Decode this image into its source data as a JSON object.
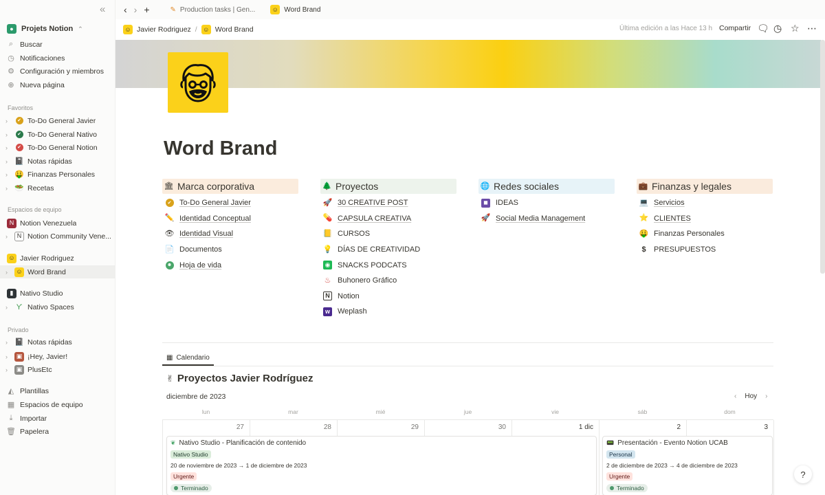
{
  "sidebar": {
    "workspace": "Projets Notion",
    "top": [
      {
        "label": "Buscar",
        "icon": "search-icon"
      },
      {
        "label": "Notificaciones",
        "icon": "clock-icon"
      },
      {
        "label": "Configuración y miembros",
        "icon": "gear-icon"
      },
      {
        "label": "Nueva página",
        "icon": "plus-circle-icon"
      }
    ],
    "favorites_title": "Favoritos",
    "favorites": [
      {
        "label": "To-Do General Javier",
        "icon": "check-circle-icon",
        "color": "#d9a21b"
      },
      {
        "label": "To-Do General Nativo",
        "icon": "check-circle-icon",
        "color": "#2b7a4b"
      },
      {
        "label": "To-Do General Notion",
        "icon": "check-circle-icon",
        "color": "#d44c47"
      },
      {
        "label": "Notas rápidas",
        "icon": "notebook-icon"
      },
      {
        "label": "Finanzas Personales",
        "icon": "money-face-icon"
      },
      {
        "label": "Recetas",
        "icon": "salad-icon"
      }
    ],
    "teams_title": "Espacios de equipo",
    "teams": [
      {
        "label": "Notion Venezuela",
        "icon": "team-logo-icon",
        "color": "#9b2b3a"
      },
      {
        "label": "Notion Community Vene...",
        "icon": "notion-logo-icon"
      },
      {
        "label": "Javier Rodriguez",
        "icon": "avatar-icon",
        "color": "#fbd11a"
      },
      {
        "label": "Word Brand",
        "icon": "avatar-icon",
        "color": "#fbd11a"
      },
      {
        "label": "Nativo Studio",
        "icon": "team-logo-icon",
        "color": "#2f3437"
      },
      {
        "label": "Nativo Spaces",
        "icon": "sprout-icon"
      }
    ],
    "private_title": "Privado",
    "private": [
      {
        "label": "Notas rápidas",
        "icon": "notebook-icon"
      },
      {
        "label": "¡Hey, Javier!",
        "icon": "photo-icon"
      },
      {
        "label": "PlusEtc",
        "icon": "photo-icon"
      }
    ],
    "bottom": [
      {
        "label": "Plantillas",
        "icon": "shapes-icon"
      },
      {
        "label": "Espacios de equipo",
        "icon": "building-icon"
      },
      {
        "label": "Importar",
        "icon": "download-icon"
      },
      {
        "label": "Papelera",
        "icon": "trash-icon"
      }
    ]
  },
  "tabs": [
    {
      "label": "Production tasks | Gen...",
      "icon": "paintbrush-icon"
    },
    {
      "label": "Word Brand",
      "icon": "avatar-icon"
    }
  ],
  "header": {
    "breadcrumb": [
      "Javier Rodriguez",
      "Word Brand"
    ],
    "breadcrumb_sep": "/",
    "last_edit": "Última edición a las Hace 13 h",
    "share": "Compartir"
  },
  "page": {
    "title": "Word Brand",
    "columns": [
      {
        "title": "Marca corporativa",
        "icon": "🏛",
        "bg": "#fbecdd",
        "items": [
          {
            "label": "To-Do General Javier",
            "icon": "✔",
            "color": "#d9a21b",
            "link": true
          },
          {
            "label": "Identidad Conceptual",
            "icon": "✏️",
            "link": true
          },
          {
            "label": "Identidad Visual",
            "icon": "👁",
            "link": true
          },
          {
            "label": "Documentos",
            "icon": "📄",
            "link": false
          },
          {
            "label": "Hoja de vida",
            "icon": "☻",
            "color": "#4aa66a",
            "link": true
          }
        ]
      },
      {
        "title": "Proyectos",
        "icon": "🌲",
        "bg": "#edf3ec",
        "items": [
          {
            "label": "30 CREATIVE POST",
            "icon": "🚀",
            "link": true
          },
          {
            "label": "CAPSULA CREATIVA",
            "icon": "💊",
            "link": true
          },
          {
            "label": "CURSOS",
            "icon": "📒",
            "link": false
          },
          {
            "label": "DÍAS DE CREATIVIDAD",
            "icon": "💡",
            "link": false
          },
          {
            "label": "SNACKS PODCATS",
            "icon": "◉",
            "color": "#1db954",
            "link": false
          },
          {
            "label": "Buhonero Gráfico",
            "icon": "♨",
            "link": false
          },
          {
            "label": "Notion",
            "icon": "N",
            "link": false
          },
          {
            "label": "Weplash",
            "icon": "w",
            "color": "#4a2a8f",
            "link": false
          }
        ]
      },
      {
        "title": "Redes sociales",
        "icon": "🌐",
        "bg": "#e7f3f8",
        "items": [
          {
            "label": "IDEAS",
            "icon": "◼",
            "color": "#6b4ca8",
            "link": false
          },
          {
            "label": "Social Media Management",
            "icon": "🚀",
            "link": true
          }
        ]
      },
      {
        "title": "Finanzas y legales",
        "icon": "💼",
        "bg": "#faebdd",
        "items": [
          {
            "label": "Servicios",
            "icon": "💻",
            "link": true
          },
          {
            "label": "CLIENTES",
            "icon": "⭐",
            "link": false
          },
          {
            "label": "Finanzas Personales",
            "icon": "🤑",
            "link": false
          },
          {
            "label": "PRESUPUESTOS",
            "icon": "$",
            "link": false
          }
        ]
      }
    ]
  },
  "calendar": {
    "tab": "Calendario",
    "title": "Proyectos Javier Rodríguez",
    "month": "diciembre de 2023",
    "today": "Hoy",
    "weekdays": [
      "lun",
      "mar",
      "mié",
      "jue",
      "vie",
      "sáb",
      "dom"
    ],
    "days": [
      "27",
      "28",
      "29",
      "30",
      "1 dic",
      "2",
      "3"
    ],
    "events": [
      {
        "title": "Nativo Studio - Planificación de contenido",
        "project": "Nativo Studio",
        "dates": "20 de noviembre de 2023 → 1 de diciembre de 2023",
        "priority": "Urgente",
        "status": "Terminado"
      },
      {
        "title": "Presentación - Evento Notion UCAB",
        "project": "Personal",
        "dates": "2 de diciembre de 2023 → 4 de diciembre de 2023",
        "priority": "Urgente",
        "status": "Terminado"
      }
    ]
  },
  "colors": {
    "accent_yellow": "#fbd11a",
    "text": "#37352f",
    "tag_green_bg": "#dbeddb",
    "tag_blue_bg": "#d3e5ef",
    "tag_red_bg": "#ffe2dd"
  }
}
